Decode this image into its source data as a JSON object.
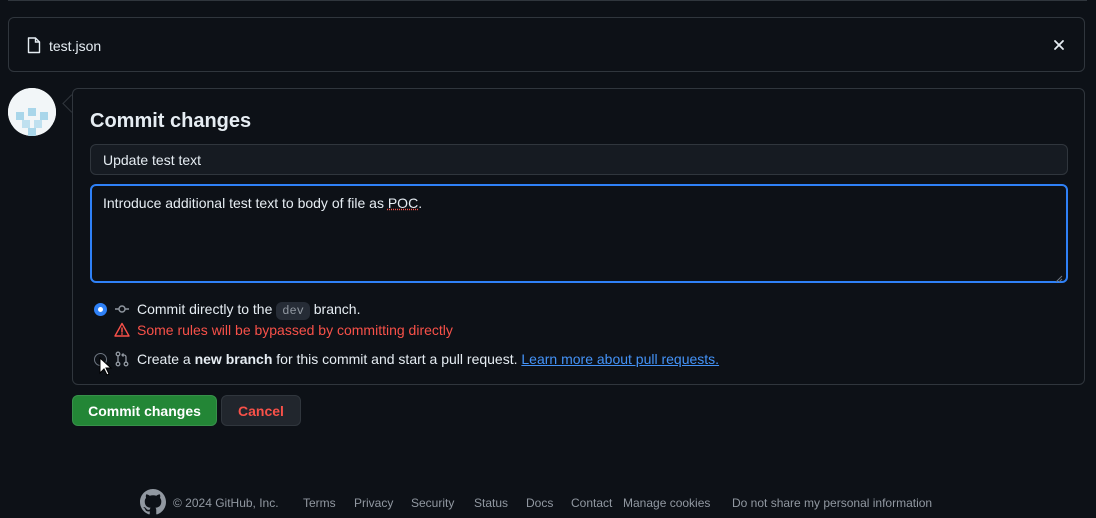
{
  "file": {
    "name": "test.json",
    "icon": "file-icon",
    "close_icon": "x-icon"
  },
  "commit": {
    "title": "Commit changes",
    "summary_value": "Update test text",
    "description_before": "Introduce additional test text to body of file as ",
    "description_flagged": "POC",
    "description_after": ".",
    "options": {
      "direct": {
        "selected": true,
        "icon": "git-commit-icon",
        "label_before": "Commit directly to the ",
        "branch": "dev",
        "label_after": " branch.",
        "warning_icon": "alert-icon",
        "warning": "Some rules will be bypassed by committing directly"
      },
      "new_branch": {
        "selected": false,
        "icon": "git-pull-request-icon",
        "label_before": "Create a ",
        "label_bold": "new branch",
        "label_after": " for this commit and start a pull request. ",
        "link": "Learn more about pull requests."
      }
    },
    "submit_label": "Commit changes",
    "cancel_label": "Cancel"
  },
  "footer": {
    "copyright": "© 2024 GitHub, Inc.",
    "links": [
      "Terms",
      "Privacy",
      "Security",
      "Status",
      "Docs",
      "Contact",
      "Manage cookies",
      "Do not share my personal information"
    ]
  },
  "colors": {
    "background": "#0d1117",
    "border": "#30363d",
    "accent": "#2f81f7",
    "danger": "#f85149",
    "primary_button": "#238636",
    "link": "#4493f8"
  }
}
